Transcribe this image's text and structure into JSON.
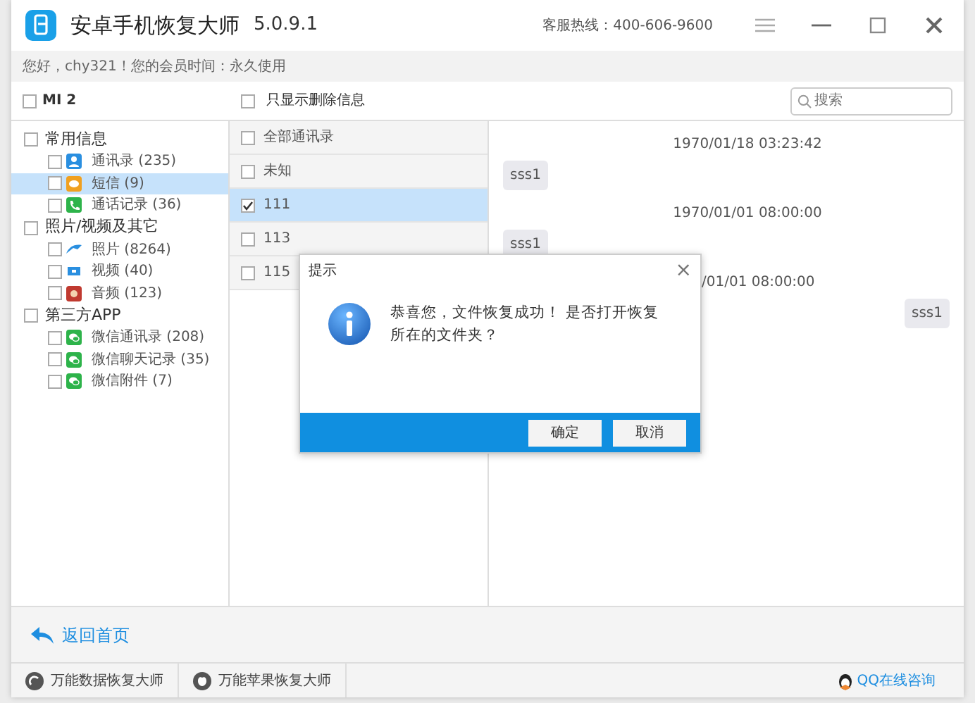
{
  "window": {
    "title": "安卓手机恢复大师",
    "version": "5.0.9.1",
    "hotline": "客服热线：400-606-9600"
  },
  "greeting": "您好，chy321！您的会员时间：永久使用",
  "toolbar": {
    "device": {
      "label": "MI 2",
      "checked": false
    },
    "filter": {
      "label": "只显示删除信息",
      "checked": false
    },
    "search": {
      "placeholder": "搜索"
    }
  },
  "tree": [
    {
      "label": "常用信息",
      "checked": false,
      "children": [
        {
          "label": "通讯录 (235)",
          "kind": "contacts",
          "checked": false,
          "selected": false
        },
        {
          "label": "短信 (9)",
          "kind": "sms",
          "checked": false,
          "selected": true
        },
        {
          "label": "通话记录 (36)",
          "kind": "calls",
          "checked": false,
          "selected": false
        }
      ]
    },
    {
      "label": "照片/视频及其它",
      "checked": false,
      "children": [
        {
          "label": "照片 (8264)",
          "kind": "photos",
          "checked": false,
          "selected": false
        },
        {
          "label": "视频 (40)",
          "kind": "video",
          "checked": false,
          "selected": false
        },
        {
          "label": "音频 (123)",
          "kind": "audio",
          "checked": false,
          "selected": false
        }
      ]
    },
    {
      "label": "第三方APP",
      "checked": false,
      "children": [
        {
          "label": "微信通讯录 (208)",
          "kind": "wechat",
          "checked": false,
          "selected": false
        },
        {
          "label": "微信聊天记录 (35)",
          "kind": "wechat",
          "checked": false,
          "selected": false
        },
        {
          "label": "微信附件 (7)",
          "kind": "wechat",
          "checked": false,
          "selected": false
        }
      ]
    }
  ],
  "contacts": [
    {
      "label": "全部通讯录",
      "checked": false,
      "selected": false
    },
    {
      "label": "未知",
      "checked": false,
      "selected": false
    },
    {
      "label": "111",
      "checked": true,
      "selected": true
    },
    {
      "label": "113",
      "checked": false,
      "selected": false
    },
    {
      "label": "115",
      "checked": false,
      "selected": false
    }
  ],
  "messages": [
    {
      "kind": "time",
      "text": "1970/01/18 03:23:42"
    },
    {
      "kind": "in",
      "text": "sss1"
    },
    {
      "kind": "time",
      "text": "1970/01/01 08:00:00"
    },
    {
      "kind": "in",
      "text": "sss1"
    },
    {
      "kind": "time_cut",
      "text": "/01/01 08:00:00"
    },
    {
      "kind": "out",
      "text": "sss1"
    }
  ],
  "dialog": {
    "title": "提示",
    "close": "×",
    "message": "恭喜您，文件恢复成功！ 是否打开恢复所在的文件夹？",
    "buttons": [
      "确定",
      "取消"
    ]
  },
  "footer": {
    "back": "返回首页"
  },
  "status_bar": {
    "links": [
      "万能数据恢复大师",
      "万能苹果恢复大师"
    ],
    "support": "QQ在线咨询"
  }
}
